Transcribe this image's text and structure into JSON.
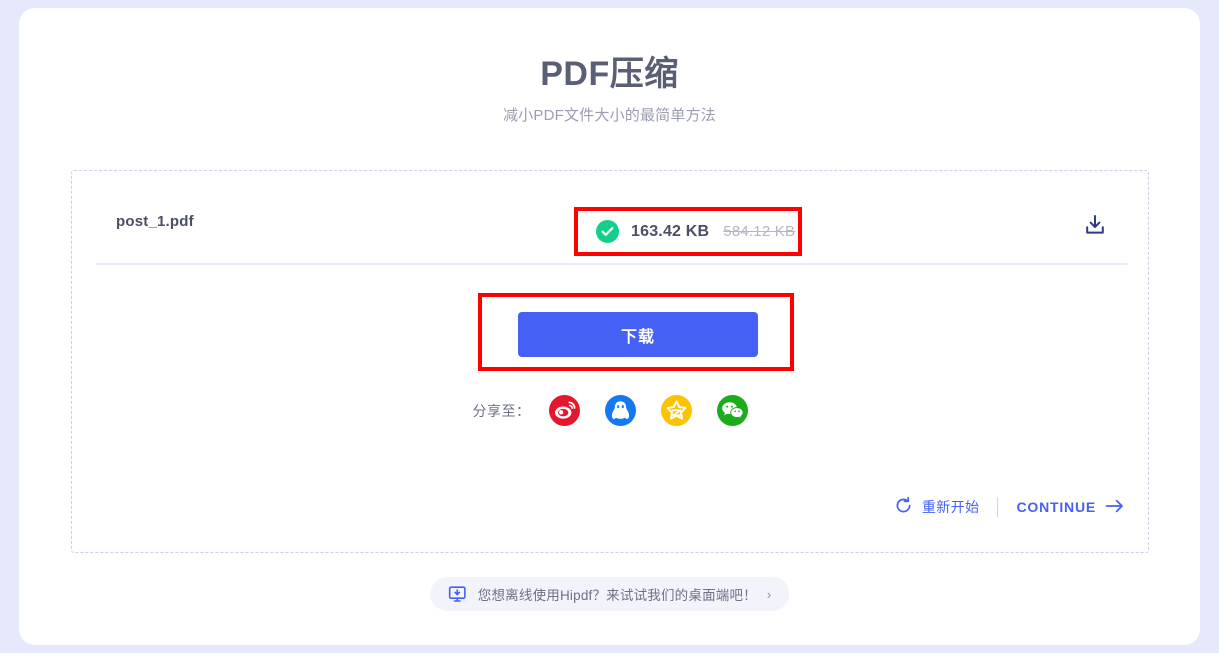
{
  "header": {
    "title": "PDF压缩",
    "subtitle": "减小PDF文件大小的最简单方法"
  },
  "file": {
    "name": "post_1.pdf",
    "compressed_size": "163.42 KB",
    "original_size": "584.12 KB",
    "status_icon": "check-circle-icon",
    "row_download_icon": "download-icon"
  },
  "actions": {
    "download_label": "下载",
    "restart_label": "重新开始",
    "restart_icon": "refresh-ccw-icon",
    "continue_label": "CONTINUE",
    "continue_icon": "arrow-right-icon"
  },
  "share": {
    "label": "分享至：",
    "items": [
      {
        "name": "weibo",
        "icon": "weibo-icon",
        "color": "#e6162d"
      },
      {
        "name": "qq",
        "icon": "qq-icon",
        "color": "#1478f0"
      },
      {
        "name": "qzone",
        "icon": "qzone-icon",
        "color": "#fdc300"
      },
      {
        "name": "wechat",
        "icon": "wechat-icon",
        "color": "#1aad19"
      }
    ]
  },
  "banner": {
    "icon": "desktop-download-icon",
    "text": "您想离线使用Hipdf？来试试我们的桌面端吧！",
    "chevron": "›"
  },
  "colors": {
    "accent": "#4560f5",
    "success": "#12d08a",
    "annotation": "#ff0000",
    "page_background": "#e6e9fb"
  }
}
